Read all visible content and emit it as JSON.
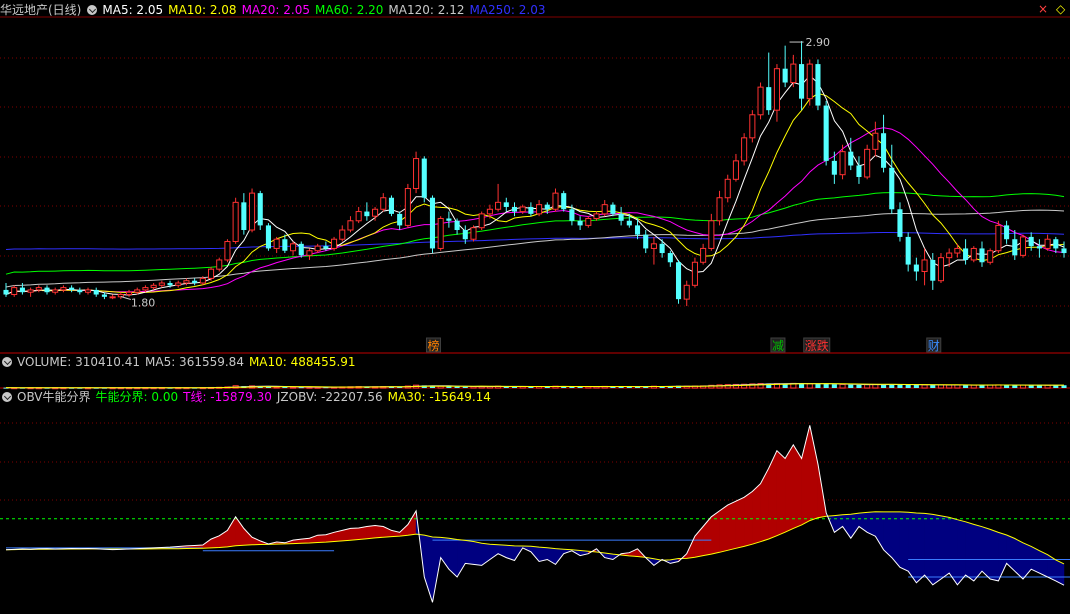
{
  "main_header": {
    "title": "华远地产(日线)",
    "indicators": [
      {
        "label": "MA5: 2.05",
        "color": "#ffffff"
      },
      {
        "label": "MA10: 2.08",
        "color": "#ffff00"
      },
      {
        "label": "MA20: 2.05",
        "color": "#ff00ff"
      },
      {
        "label": "MA60: 2.20",
        "color": "#00ff00"
      },
      {
        "label": "MA120: 2.12",
        "color": "#c8c8c8"
      },
      {
        "label": "MA250: 2.03",
        "color": "#3030ff"
      }
    ]
  },
  "volume_header": {
    "items": [
      {
        "label": "VOLUME: 310410.41",
        "color": "#c8c8c8"
      },
      {
        "label": "MA5: 361559.84",
        "color": "#c8c8c8"
      },
      {
        "label": "MA10: 488455.91",
        "color": "#ffff00"
      }
    ]
  },
  "obv_header": {
    "items": [
      {
        "label": "OBV牛能分界",
        "color": "#c8c8c8"
      },
      {
        "label": "牛能分界: 0.00",
        "color": "#00ff00"
      },
      {
        "label": "T线: -15879.30",
        "color": "#ff00ff"
      },
      {
        "label": "JZOBV: -22207.56",
        "color": "#c8c8c8"
      },
      {
        "label": "MA30: -15649.14",
        "color": "#ffff00"
      }
    ]
  },
  "window_controls": {
    "close": "×",
    "diamond": "◇"
  },
  "colors": {
    "up": "#ff3232",
    "down": "#54ffff",
    "bg": "#000000",
    "grid": "#800000",
    "obv_red": "#b00000",
    "obv_blue": "#000080"
  },
  "chart_data": [
    {
      "type": "candlestick",
      "name": "华远地产(日线)",
      "y_range": [
        1.62,
        3.0
      ],
      "annotations": [
        {
          "text": "2.90",
          "index": 97,
          "value": 2.9
        },
        {
          "text": "1.80",
          "index": 14,
          "value": 1.8
        }
      ],
      "event_tags": [
        {
          "text": "榜",
          "index": 52,
          "color": "#ff8000"
        },
        {
          "text": "减",
          "index": 94,
          "color": "#00c000"
        },
        {
          "text": "涨跌",
          "index": 98,
          "color": "#ff3232"
        },
        {
          "text": "财",
          "index": 113,
          "color": "#3a8cff"
        }
      ],
      "ohlc": [
        [
          1.82,
          1.85,
          1.79,
          1.8
        ],
        [
          1.8,
          1.84,
          1.79,
          1.83
        ],
        [
          1.83,
          1.85,
          1.8,
          1.81
        ],
        [
          1.81,
          1.83,
          1.79,
          1.82
        ],
        [
          1.82,
          1.84,
          1.81,
          1.83
        ],
        [
          1.83,
          1.84,
          1.8,
          1.81
        ],
        [
          1.81,
          1.83,
          1.8,
          1.82
        ],
        [
          1.82,
          1.84,
          1.81,
          1.83
        ],
        [
          1.83,
          1.84,
          1.81,
          1.82
        ],
        [
          1.82,
          1.83,
          1.8,
          1.81
        ],
        [
          1.81,
          1.83,
          1.8,
          1.82
        ],
        [
          1.82,
          1.83,
          1.79,
          1.8
        ],
        [
          1.8,
          1.81,
          1.78,
          1.79
        ],
        [
          1.79,
          1.8,
          1.78,
          1.79
        ],
        [
          1.79,
          1.81,
          1.78,
          1.8
        ],
        [
          1.8,
          1.82,
          1.79,
          1.81
        ],
        [
          1.81,
          1.83,
          1.8,
          1.82
        ],
        [
          1.82,
          1.84,
          1.81,
          1.83
        ],
        [
          1.83,
          1.85,
          1.82,
          1.84
        ],
        [
          1.84,
          1.86,
          1.83,
          1.85
        ],
        [
          1.85,
          1.86,
          1.83,
          1.84
        ],
        [
          1.84,
          1.86,
          1.83,
          1.85
        ],
        [
          1.85,
          1.87,
          1.84,
          1.86
        ],
        [
          1.86,
          1.87,
          1.84,
          1.85
        ],
        [
          1.85,
          1.88,
          1.84,
          1.87
        ],
        [
          1.87,
          1.92,
          1.86,
          1.91
        ],
        [
          1.91,
          1.96,
          1.9,
          1.95
        ],
        [
          1.95,
          2.04,
          1.94,
          2.03
        ],
        [
          2.03,
          2.22,
          2.02,
          2.2
        ],
        [
          2.2,
          2.24,
          2.06,
          2.08
        ],
        [
          2.08,
          2.26,
          2.07,
          2.24
        ],
        [
          2.24,
          2.25,
          2.08,
          2.1
        ],
        [
          2.1,
          2.11,
          1.99,
          2.0
        ],
        [
          2.0,
          2.05,
          1.98,
          2.04
        ],
        [
          2.04,
          2.06,
          1.98,
          1.99
        ],
        [
          1.99,
          2.03,
          1.97,
          2.02
        ],
        [
          2.02,
          2.03,
          1.96,
          1.97
        ],
        [
          1.97,
          2.0,
          1.95,
          1.99
        ],
        [
          1.99,
          2.02,
          1.98,
          2.01
        ],
        [
          2.01,
          2.03,
          1.99,
          2.0
        ],
        [
          2.0,
          2.05,
          1.99,
          2.04
        ],
        [
          2.04,
          2.1,
          2.03,
          2.08
        ],
        [
          2.08,
          2.14,
          2.07,
          2.12
        ],
        [
          2.12,
          2.18,
          2.11,
          2.16
        ],
        [
          2.16,
          2.2,
          2.12,
          2.14
        ],
        [
          2.14,
          2.18,
          2.12,
          2.17
        ],
        [
          2.17,
          2.24,
          2.16,
          2.22
        ],
        [
          2.22,
          2.23,
          2.14,
          2.15
        ],
        [
          2.15,
          2.16,
          2.08,
          2.1
        ],
        [
          2.1,
          2.28,
          2.09,
          2.26
        ],
        [
          2.26,
          2.42,
          2.24,
          2.39
        ],
        [
          2.39,
          2.4,
          2.2,
          2.22
        ],
        [
          2.22,
          2.23,
          1.98,
          2.0
        ],
        [
          2.0,
          2.14,
          1.99,
          2.13
        ],
        [
          2.13,
          2.16,
          2.09,
          2.12
        ],
        [
          2.12,
          2.13,
          2.06,
          2.08
        ],
        [
          2.08,
          2.1,
          2.02,
          2.04
        ],
        [
          2.04,
          2.1,
          2.03,
          2.09
        ],
        [
          2.09,
          2.16,
          2.08,
          2.15
        ],
        [
          2.15,
          2.19,
          2.13,
          2.17
        ],
        [
          2.17,
          2.28,
          2.16,
          2.2
        ],
        [
          2.2,
          2.22,
          2.16,
          2.18
        ],
        [
          2.18,
          2.2,
          2.14,
          2.16
        ],
        [
          2.16,
          2.19,
          2.15,
          2.18
        ],
        [
          2.18,
          2.2,
          2.14,
          2.15
        ],
        [
          2.15,
          2.21,
          2.14,
          2.19
        ],
        [
          2.19,
          2.2,
          2.15,
          2.17
        ],
        [
          2.17,
          2.26,
          2.16,
          2.24
        ],
        [
          2.24,
          2.25,
          2.16,
          2.17
        ],
        [
          2.17,
          2.19,
          2.1,
          2.12
        ],
        [
          2.12,
          2.14,
          2.08,
          2.1
        ],
        [
          2.1,
          2.14,
          2.09,
          2.13
        ],
        [
          2.13,
          2.16,
          2.12,
          2.15
        ],
        [
          2.15,
          2.21,
          2.14,
          2.19
        ],
        [
          2.19,
          2.2,
          2.14,
          2.15
        ],
        [
          2.15,
          2.18,
          2.1,
          2.12
        ],
        [
          2.12,
          2.15,
          2.09,
          2.1
        ],
        [
          2.1,
          2.13,
          2.04,
          2.06
        ],
        [
          2.06,
          2.08,
          1.98,
          2.0
        ],
        [
          2.0,
          2.05,
          1.93,
          2.02
        ],
        [
          2.02,
          2.04,
          1.96,
          1.98
        ],
        [
          1.98,
          1.99,
          1.92,
          1.94
        ],
        [
          1.94,
          1.95,
          1.76,
          1.78
        ],
        [
          1.78,
          1.86,
          1.75,
          1.84
        ],
        [
          1.84,
          1.96,
          1.83,
          1.94
        ],
        [
          1.94,
          2.02,
          1.93,
          2.0
        ],
        [
          2.0,
          2.15,
          1.99,
          2.12
        ],
        [
          2.12,
          2.25,
          2.1,
          2.22
        ],
        [
          2.22,
          2.32,
          2.2,
          2.3
        ],
        [
          2.3,
          2.41,
          2.29,
          2.38
        ],
        [
          2.38,
          2.5,
          2.36,
          2.48
        ],
        [
          2.48,
          2.6,
          2.46,
          2.58
        ],
        [
          2.58,
          2.72,
          2.56,
          2.7
        ],
        [
          2.7,
          2.85,
          2.58,
          2.6
        ],
        [
          2.6,
          2.8,
          2.55,
          2.78
        ],
        [
          2.78,
          2.88,
          2.7,
          2.72
        ],
        [
          2.72,
          2.84,
          2.7,
          2.8
        ],
        [
          2.8,
          2.9,
          2.6,
          2.65
        ],
        [
          2.65,
          2.82,
          2.62,
          2.8
        ],
        [
          2.8,
          2.82,
          2.6,
          2.62
        ],
        [
          2.62,
          2.64,
          2.36,
          2.38
        ],
        [
          2.38,
          2.42,
          2.28,
          2.32
        ],
        [
          2.32,
          2.45,
          2.3,
          2.42
        ],
        [
          2.42,
          2.48,
          2.34,
          2.36
        ],
        [
          2.36,
          2.4,
          2.28,
          2.31
        ],
        [
          2.31,
          2.45,
          2.3,
          2.43
        ],
        [
          2.43,
          2.55,
          2.4,
          2.5
        ],
        [
          2.5,
          2.58,
          2.33,
          2.35
        ],
        [
          2.35,
          2.45,
          2.15,
          2.17
        ],
        [
          2.17,
          2.2,
          2.03,
          2.05
        ],
        [
          2.05,
          2.07,
          1.9,
          1.93
        ],
        [
          1.93,
          1.96,
          1.86,
          1.9
        ],
        [
          1.9,
          2.0,
          1.84,
          1.95
        ],
        [
          1.95,
          1.98,
          1.82,
          1.86
        ],
        [
          1.86,
          1.98,
          1.85,
          1.96
        ],
        [
          1.96,
          2.0,
          1.92,
          1.98
        ],
        [
          1.98,
          2.02,
          1.96,
          2.0
        ],
        [
          2.0,
          2.04,
          1.93,
          1.95
        ],
        [
          1.95,
          2.01,
          1.94,
          2.0
        ],
        [
          2.0,
          2.03,
          1.92,
          1.94
        ],
        [
          1.94,
          2.0,
          1.93,
          1.99
        ],
        [
          1.99,
          2.12,
          1.98,
          2.1
        ],
        [
          2.1,
          2.12,
          2.02,
          2.04
        ],
        [
          2.04,
          2.08,
          1.95,
          1.97
        ],
        [
          1.97,
          2.06,
          1.96,
          2.05
        ],
        [
          2.05,
          2.07,
          1.99,
          2.01
        ],
        [
          2.01,
          2.04,
          1.96,
          2.0
        ],
        [
          2.0,
          2.06,
          1.99,
          2.04
        ],
        [
          2.04,
          2.05,
          1.98,
          2.0
        ],
        [
          2.0,
          2.03,
          1.96,
          1.98
        ]
      ],
      "ma_lines": [
        {
          "name": "MA5",
          "period": 5,
          "color": "#ffffff"
        },
        {
          "name": "MA10",
          "period": 10,
          "color": "#ffff00"
        },
        {
          "name": "MA20",
          "period": 20,
          "color": "#ff00ff"
        },
        {
          "name": "MA60",
          "period": 60,
          "color": "#00ff00"
        },
        {
          "name": "MA120",
          "period": 120,
          "color": "#c8c8c8"
        },
        {
          "name": "MA250",
          "period": 250,
          "color": "#3030ff"
        }
      ]
    },
    {
      "type": "bar",
      "name": "VOLUME",
      "y_range": [
        0,
        1800000
      ],
      "values": [
        40000,
        38000,
        36000,
        35000,
        34000,
        33000,
        32000,
        31000,
        30000,
        30000,
        30000,
        32000,
        33000,
        34000,
        34000,
        33000,
        32000,
        32000,
        33000,
        34000,
        35000,
        36000,
        37000,
        38000,
        40000,
        60000,
        80000,
        120000,
        260000,
        220000,
        240000,
        200000,
        150000,
        120000,
        110000,
        100000,
        95000,
        90000,
        90000,
        95000,
        100000,
        120000,
        140000,
        160000,
        150000,
        140000,
        160000,
        150000,
        140000,
        220000,
        320000,
        300000,
        250000,
        200000,
        180000,
        160000,
        150000,
        150000,
        160000,
        170000,
        200000,
        180000,
        170000,
        160000,
        160000,
        170000,
        160000,
        200000,
        180000,
        160000,
        150000,
        150000,
        160000,
        180000,
        170000,
        160000,
        150000,
        160000,
        180000,
        200000,
        180000,
        170000,
        250000,
        210000,
        220000,
        240000,
        300000,
        350000,
        380000,
        400000,
        420000,
        460000,
        500000,
        520000,
        500000,
        480000,
        520000,
        500000,
        480000,
        500000,
        460000,
        420000,
        400000,
        380000,
        360000,
        380000,
        400000,
        420000,
        400000,
        380000,
        360000,
        350000,
        340000,
        350000,
        340000,
        330000,
        330000,
        320000,
        320000,
        330000,
        340000,
        350000,
        330000,
        320000,
        330000,
        320000,
        310000,
        315000,
        312000,
        310410
      ]
    },
    {
      "type": "area",
      "name": "OBV牛能分界",
      "y_range": [
        -36000,
        70000
      ],
      "zero_line": 0,
      "obv_values": [
        -4000,
        -3800,
        -3600,
        -3700,
        -3500,
        -3400,
        -3600,
        -3500,
        -3300,
        -3400,
        -3300,
        -3500,
        -3700,
        -3900,
        -3800,
        -3600,
        -3400,
        -3200,
        -3000,
        -2800,
        -2600,
        -2300,
        -2000,
        -1800,
        -1500,
        1500,
        3200,
        6000,
        13000,
        7000,
        2500,
        600,
        -1000,
        0,
        -400,
        1000,
        1500,
        2000,
        3500,
        3800,
        5000,
        6000,
        7000,
        7200,
        8000,
        8500,
        8000,
        6000,
        5000,
        9000,
        16000,
        -18000,
        -31000,
        -8000,
        -14000,
        -18000,
        -11000,
        -11500,
        -12000,
        -9000,
        -6000,
        -8000,
        -9500,
        -3000,
        -5000,
        -10000,
        -9000,
        -11500,
        -6000,
        -4500,
        -7000,
        -6000,
        -3500,
        -8000,
        -9000,
        -6000,
        -5500,
        -3500,
        -8000,
        -12000,
        -9000,
        -11000,
        -10000,
        -6000,
        3000,
        8000,
        13000,
        16000,
        19000,
        21000,
        23000,
        26000,
        30000,
        38000,
        47000,
        43000,
        50000,
        43000,
        60000,
        40000,
        15000,
        5000,
        8000,
        2000,
        8000,
        5000,
        3000,
        -4000,
        -8000,
        -13000,
        -15000,
        -21000,
        -17000,
        -22000,
        -19000,
        -16000,
        -22000,
        -17000,
        -20000,
        -15000,
        -19000,
        -20000,
        -11000,
        -15000,
        -19000,
        -14000,
        -16000,
        -18000,
        -20000,
        -22207
      ],
      "t_line": -15879.3,
      "jzobv": -22207.56,
      "ma30_period": 30,
      "bull_boundary": 0.0,
      "bull_boundary_color": "#00ff00",
      "t_line_color": "#ff00ff",
      "ma30_color": "#ffff00"
    }
  ]
}
